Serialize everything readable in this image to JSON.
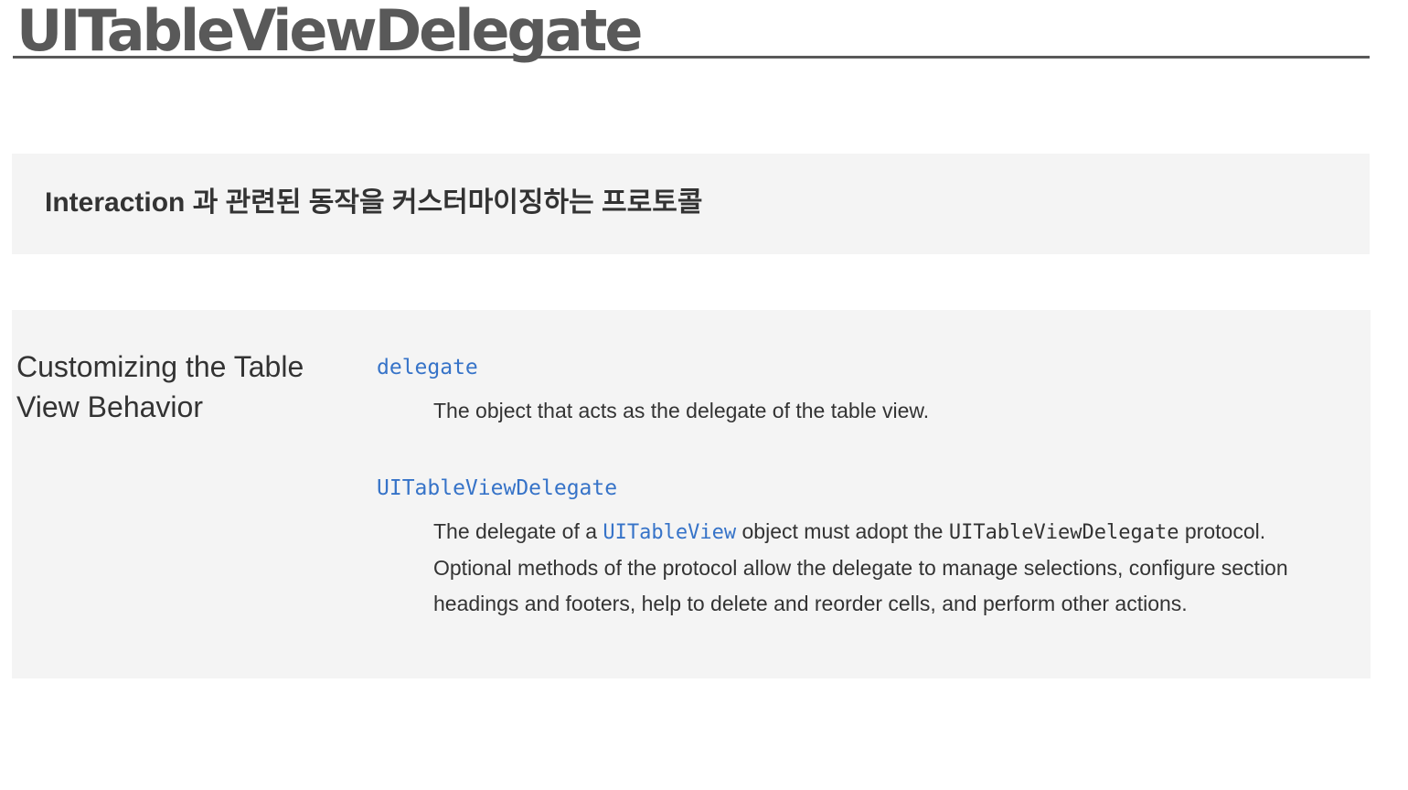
{
  "header": {
    "title": "UITableViewDelegate"
  },
  "summary": {
    "text": "Interaction 과 관련된 동작을 커스터마이징하는 프로토콜"
  },
  "topic": {
    "heading": "Customizing the Table View Behavior",
    "items": [
      {
        "symbol": "delegate",
        "description": "The object that acts as the delegate of the table view."
      },
      {
        "symbol": "UITableViewDelegate",
        "description_parts": {
          "before": "The delegate of a ",
          "link": "UITableView",
          "middle": " object must adopt the ",
          "code": "UITableViewDelegate",
          "after": " protocol. Optional methods of the protocol allow the delegate to manage selections, configure section headings and footers, help to delete and reorder cells, and perform other actions."
        }
      }
    ]
  },
  "colors": {
    "title": "#595959",
    "link": "#3673c8",
    "panel_background": "#f4f4f4",
    "text": "#333333"
  }
}
